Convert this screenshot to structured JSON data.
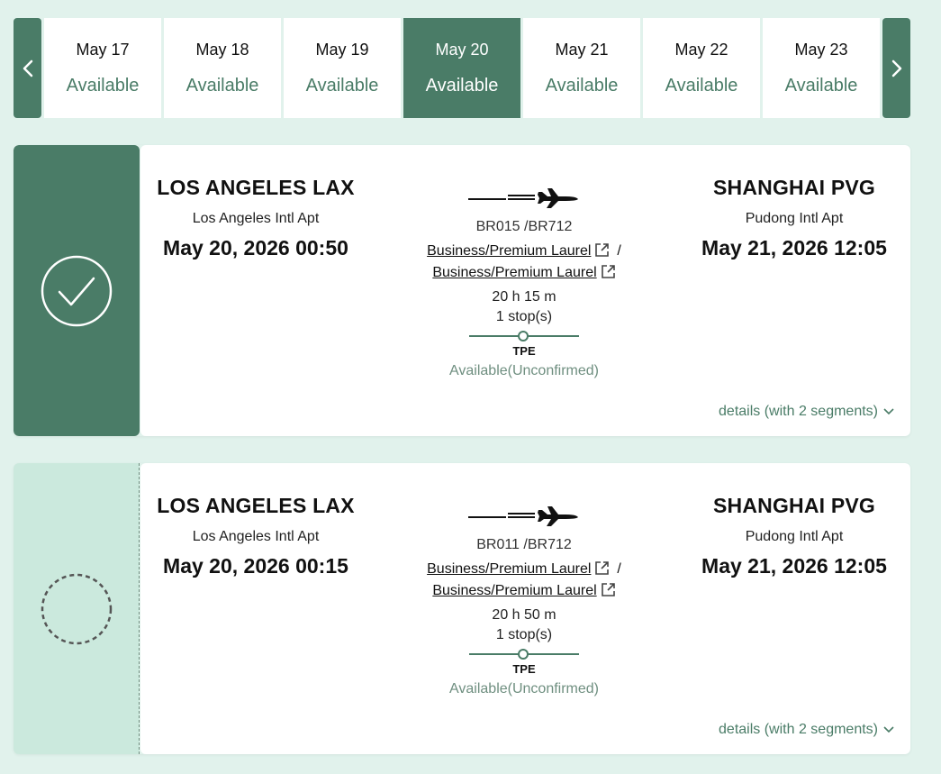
{
  "date_strip": {
    "prev_icon": "chevron-left-icon",
    "next_icon": "chevron-right-icon",
    "dates": [
      {
        "date": "May 17",
        "status": "Available",
        "selected": false
      },
      {
        "date": "May 18",
        "status": "Available",
        "selected": false
      },
      {
        "date": "May 19",
        "status": "Available",
        "selected": false
      },
      {
        "date": "May 20",
        "status": "Available",
        "selected": true
      },
      {
        "date": "May 21",
        "status": "Available",
        "selected": false
      },
      {
        "date": "May 22",
        "status": "Available",
        "selected": false
      },
      {
        "date": "May 23",
        "status": "Available",
        "selected": false
      }
    ]
  },
  "flights": [
    {
      "selected": true,
      "origin": {
        "city": "LOS ANGELES LAX",
        "airport": "Los Angeles Intl Apt",
        "datetime": "May 20, 2026 00:50"
      },
      "destination": {
        "city": "SHANGHAI PVG",
        "airport": "Pudong Intl Apt",
        "datetime": "May 21, 2026 12:05"
      },
      "flight_numbers": "BR015 /BR712",
      "cabin_1": "Business/Premium Laurel",
      "separator": "/",
      "cabin_2": "Business/Premium Laurel",
      "duration": "20 h 15 m",
      "stops": "1 stop(s)",
      "stop_code": "TPE",
      "availability": "Available(Unconfirmed)",
      "details": "details (with 2 segments)"
    },
    {
      "selected": false,
      "origin": {
        "city": "LOS ANGELES LAX",
        "airport": "Los Angeles Intl Apt",
        "datetime": "May 20, 2026 00:15"
      },
      "destination": {
        "city": "SHANGHAI PVG",
        "airport": "Pudong Intl Apt",
        "datetime": "May 21, 2026 12:05"
      },
      "flight_numbers": "BR011 /BR712",
      "cabin_1": "Business/Premium Laurel",
      "separator": "/",
      "cabin_2": "Business/Premium Laurel",
      "duration": "20 h 50 m",
      "stops": "1 stop(s)",
      "stop_code": "TPE",
      "availability": "Available(Unconfirmed)",
      "details": "details (with 2 segments)"
    }
  ],
  "colors": {
    "brand": "#4a7c67",
    "page_bg": "#e1f2ec",
    "unselected_panel": "#cbe9dd",
    "muted_text": "#6f8f80"
  }
}
